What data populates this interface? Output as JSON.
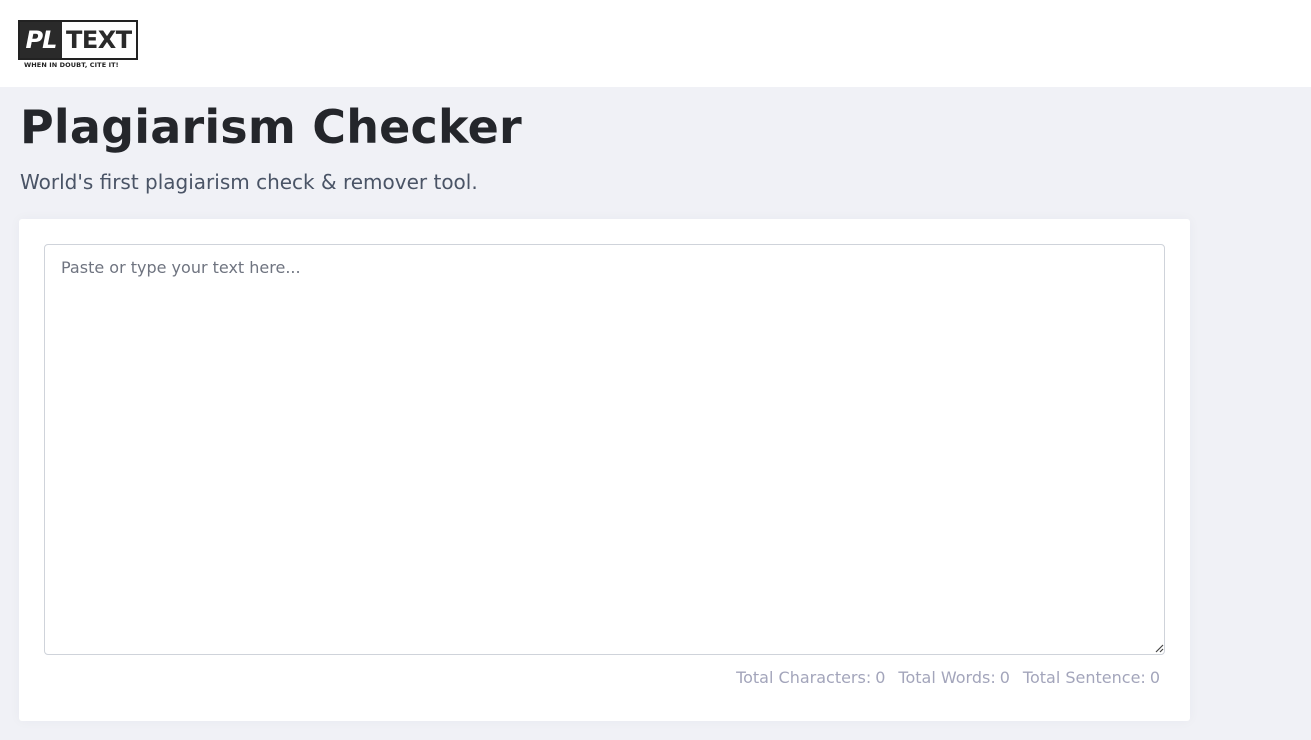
{
  "header": {
    "logo": {
      "mark": "PL",
      "word": "TEXT",
      "tagline": "WHEN IN DOUBT, CITE IT!"
    }
  },
  "main": {
    "title": "Plagiarism Checker",
    "subtitle": "World's first plagiarism check & remover tool.",
    "editor": {
      "placeholder": "Paste or type your text here...",
      "value": ""
    },
    "stats": {
      "characters_label": "Total Characters:",
      "characters_value": "0",
      "words_label": "Total Words:",
      "words_value": "0",
      "sentences_label": "Total Sentence:",
      "sentences_value": "0"
    }
  },
  "colors": {
    "page_background": "#f0f1f6",
    "card_background": "#ffffff",
    "title_color": "#24262b",
    "subtitle_color": "#4a5466",
    "stats_color": "#a3a5bb"
  }
}
